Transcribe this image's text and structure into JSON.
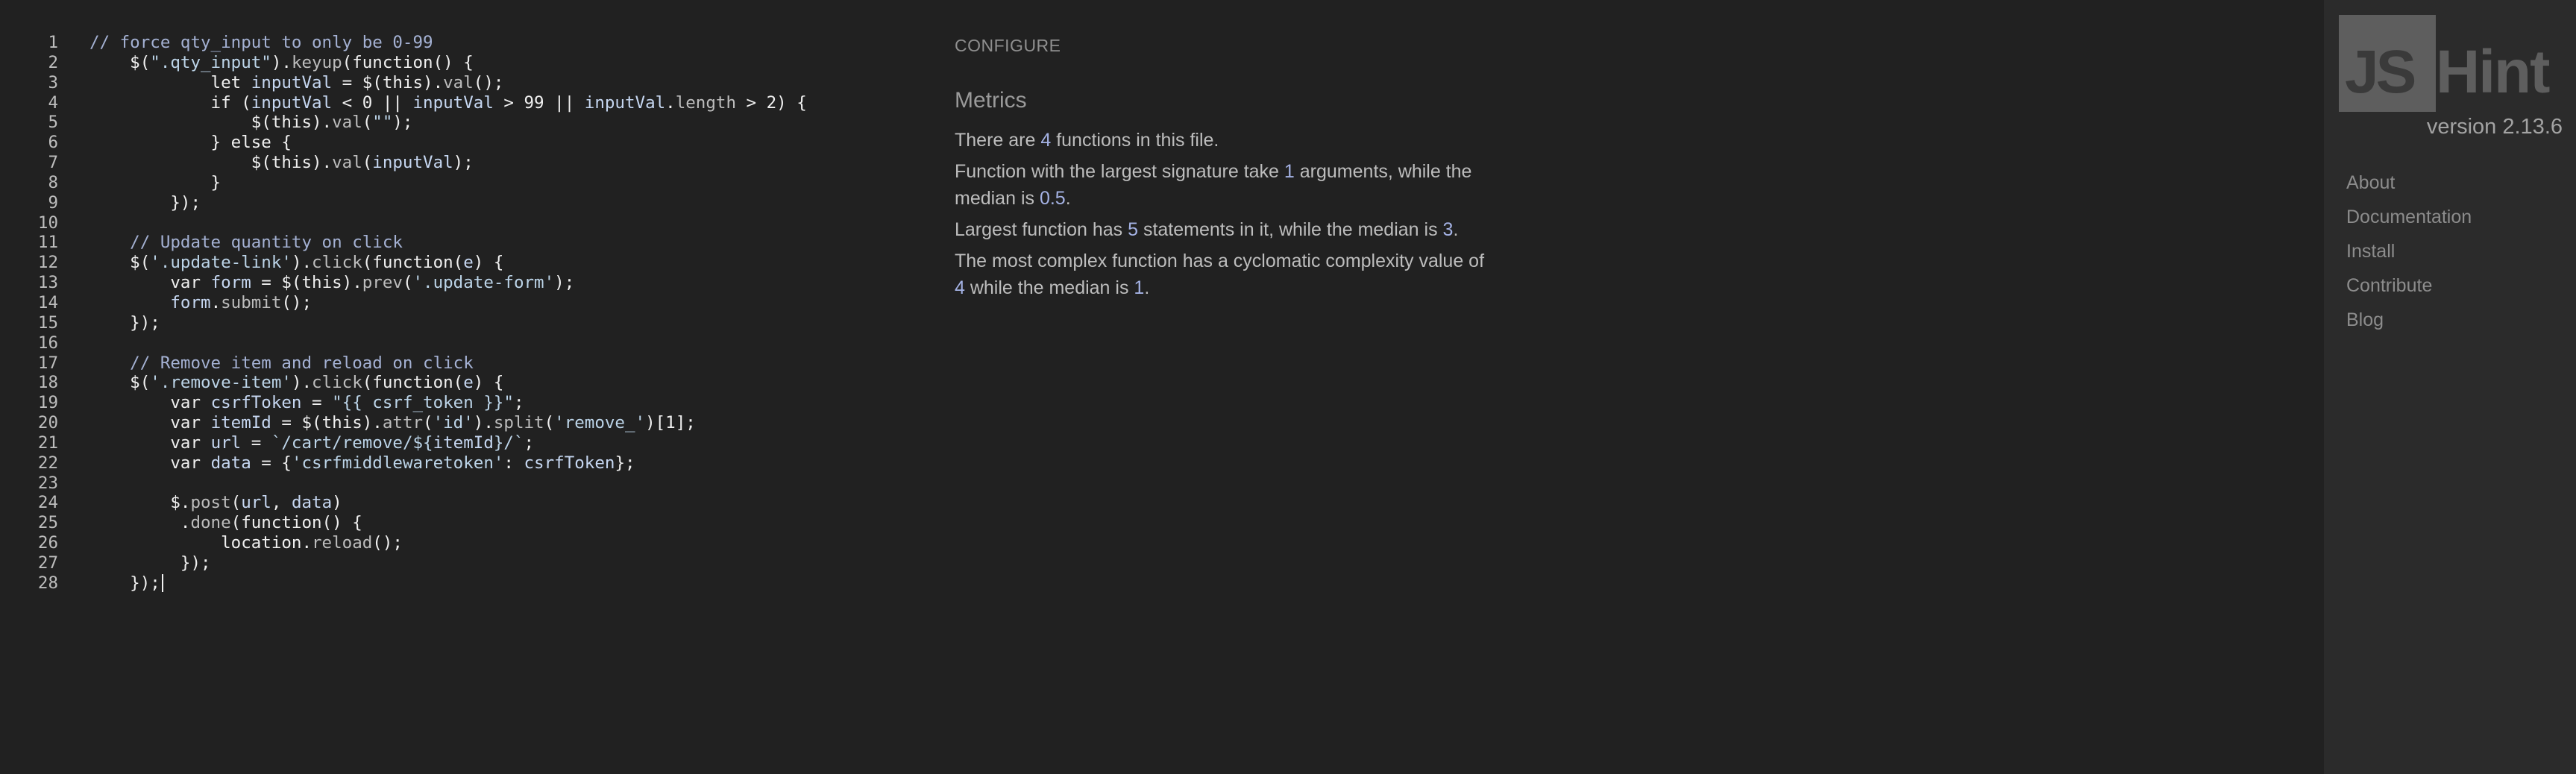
{
  "editor": {
    "lines": [
      {
        "n": "1",
        "tokens": [
          {
            "t": "// force qty_input to only be 0-99",
            "c": "cm"
          }
        ]
      },
      {
        "n": "2",
        "tokens": [
          {
            "t": "    $(",
            "c": "kw"
          },
          {
            "t": "\".qty_input\"",
            "c": "st"
          },
          {
            "t": ").",
            "c": "kw"
          },
          {
            "t": "keyup",
            "c": "mb"
          },
          {
            "t": "(function() {",
            "c": "kw"
          }
        ]
      },
      {
        "n": "3",
        "tokens": [
          {
            "t": "            let ",
            "c": "kw"
          },
          {
            "t": "inputVal",
            "c": "id"
          },
          {
            "t": " = $(this).",
            "c": "kw"
          },
          {
            "t": "val",
            "c": "mb"
          },
          {
            "t": "();",
            "c": "kw"
          }
        ]
      },
      {
        "n": "4",
        "tokens": [
          {
            "t": "            if (",
            "c": "kw"
          },
          {
            "t": "inputVal",
            "c": "id"
          },
          {
            "t": " < 0 || ",
            "c": "kw"
          },
          {
            "t": "inputVal",
            "c": "id"
          },
          {
            "t": " > 99 || ",
            "c": "kw"
          },
          {
            "t": "inputVal",
            "c": "id"
          },
          {
            "t": ".",
            "c": "kw"
          },
          {
            "t": "length",
            "c": "mb"
          },
          {
            "t": " > 2) {",
            "c": "kw"
          }
        ]
      },
      {
        "n": "5",
        "tokens": [
          {
            "t": "                $(this).",
            "c": "kw"
          },
          {
            "t": "val",
            "c": "mb"
          },
          {
            "t": "(",
            "c": "kw"
          },
          {
            "t": "\"\"",
            "c": "st"
          },
          {
            "t": ");",
            "c": "kw"
          }
        ]
      },
      {
        "n": "6",
        "tokens": [
          {
            "t": "            } else {",
            "c": "kw"
          }
        ]
      },
      {
        "n": "7",
        "tokens": [
          {
            "t": "                $(this).",
            "c": "kw"
          },
          {
            "t": "val",
            "c": "mb"
          },
          {
            "t": "(",
            "c": "kw"
          },
          {
            "t": "inputVal",
            "c": "id"
          },
          {
            "t": ");",
            "c": "kw"
          }
        ]
      },
      {
        "n": "8",
        "tokens": [
          {
            "t": "            }",
            "c": "kw"
          }
        ]
      },
      {
        "n": "9",
        "tokens": [
          {
            "t": "        });",
            "c": "kw"
          }
        ]
      },
      {
        "n": "10",
        "tokens": []
      },
      {
        "n": "11",
        "tokens": [
          {
            "t": "    // Update quantity on click",
            "c": "cm"
          }
        ]
      },
      {
        "n": "12",
        "tokens": [
          {
            "t": "    $(",
            "c": "kw"
          },
          {
            "t": "'.update-link'",
            "c": "st"
          },
          {
            "t": ").",
            "c": "kw"
          },
          {
            "t": "click",
            "c": "mb"
          },
          {
            "t": "(function(",
            "c": "kw"
          },
          {
            "t": "e",
            "c": "id"
          },
          {
            "t": ") {",
            "c": "kw"
          }
        ]
      },
      {
        "n": "13",
        "tokens": [
          {
            "t": "        var ",
            "c": "kw"
          },
          {
            "t": "form",
            "c": "id"
          },
          {
            "t": " = $(this).",
            "c": "kw"
          },
          {
            "t": "prev",
            "c": "mb"
          },
          {
            "t": "(",
            "c": "kw"
          },
          {
            "t": "'.update-form'",
            "c": "st"
          },
          {
            "t": ");",
            "c": "kw"
          }
        ]
      },
      {
        "n": "14",
        "tokens": [
          {
            "t": "        ",
            "c": "kw"
          },
          {
            "t": "form",
            "c": "id"
          },
          {
            "t": ".",
            "c": "kw"
          },
          {
            "t": "submit",
            "c": "mb"
          },
          {
            "t": "();",
            "c": "kw"
          }
        ]
      },
      {
        "n": "15",
        "tokens": [
          {
            "t": "    });",
            "c": "kw"
          }
        ]
      },
      {
        "n": "16",
        "tokens": []
      },
      {
        "n": "17",
        "tokens": [
          {
            "t": "    // Remove item and reload on click",
            "c": "cm"
          }
        ]
      },
      {
        "n": "18",
        "tokens": [
          {
            "t": "    $(",
            "c": "kw"
          },
          {
            "t": "'.remove-item'",
            "c": "st"
          },
          {
            "t": ").",
            "c": "kw"
          },
          {
            "t": "click",
            "c": "mb"
          },
          {
            "t": "(function(",
            "c": "kw"
          },
          {
            "t": "e",
            "c": "id"
          },
          {
            "t": ") {",
            "c": "kw"
          }
        ]
      },
      {
        "n": "19",
        "tokens": [
          {
            "t": "        var ",
            "c": "kw"
          },
          {
            "t": "csrfToken",
            "c": "id"
          },
          {
            "t": " = ",
            "c": "kw"
          },
          {
            "t": "\"{{ csrf_token }}\"",
            "c": "st"
          },
          {
            "t": ";",
            "c": "kw"
          }
        ]
      },
      {
        "n": "20",
        "tokens": [
          {
            "t": "        var ",
            "c": "kw"
          },
          {
            "t": "itemId",
            "c": "id"
          },
          {
            "t": " = $(this).",
            "c": "kw"
          },
          {
            "t": "attr",
            "c": "mb"
          },
          {
            "t": "(",
            "c": "kw"
          },
          {
            "t": "'id'",
            "c": "st"
          },
          {
            "t": ").",
            "c": "kw"
          },
          {
            "t": "split",
            "c": "mb"
          },
          {
            "t": "(",
            "c": "kw"
          },
          {
            "t": "'remove_'",
            "c": "st"
          },
          {
            "t": ")[1];",
            "c": "kw"
          }
        ]
      },
      {
        "n": "21",
        "tokens": [
          {
            "t": "        var ",
            "c": "kw"
          },
          {
            "t": "url",
            "c": "id"
          },
          {
            "t": " = ",
            "c": "kw"
          },
          {
            "t": "`/cart/remove/${",
            "c": "st"
          },
          {
            "t": "itemId",
            "c": "id"
          },
          {
            "t": "}/`",
            "c": "st"
          },
          {
            "t": ";",
            "c": "kw"
          }
        ]
      },
      {
        "n": "22",
        "tokens": [
          {
            "t": "        var ",
            "c": "kw"
          },
          {
            "t": "data",
            "c": "id"
          },
          {
            "t": " = {",
            "c": "kw"
          },
          {
            "t": "'csrfmiddlewaretoken'",
            "c": "st"
          },
          {
            "t": ": ",
            "c": "kw"
          },
          {
            "t": "csrfToken",
            "c": "id"
          },
          {
            "t": "};",
            "c": "kw"
          }
        ]
      },
      {
        "n": "23",
        "tokens": []
      },
      {
        "n": "24",
        "tokens": [
          {
            "t": "        $.",
            "c": "kw"
          },
          {
            "t": "post",
            "c": "mb"
          },
          {
            "t": "(",
            "c": "kw"
          },
          {
            "t": "url",
            "c": "id"
          },
          {
            "t": ", ",
            "c": "kw"
          },
          {
            "t": "data",
            "c": "id"
          },
          {
            "t": ")",
            "c": "kw"
          }
        ]
      },
      {
        "n": "25",
        "tokens": [
          {
            "t": "         .",
            "c": "kw"
          },
          {
            "t": "done",
            "c": "mb"
          },
          {
            "t": "(function() {",
            "c": "kw"
          }
        ]
      },
      {
        "n": "26",
        "tokens": [
          {
            "t": "             location.",
            "c": "kw"
          },
          {
            "t": "reload",
            "c": "mb"
          },
          {
            "t": "();",
            "c": "kw"
          }
        ]
      },
      {
        "n": "27",
        "tokens": [
          {
            "t": "         });",
            "c": "kw"
          }
        ]
      },
      {
        "n": "28",
        "tokens": [
          {
            "t": "    });",
            "c": "kw"
          }
        ],
        "cursor": true
      }
    ]
  },
  "report": {
    "configure_label": "CONFIGURE",
    "metrics_title": "Metrics",
    "line1": {
      "a": "There are ",
      "b": "4",
      "c": " functions in this file."
    },
    "line2": {
      "a": "Function with the largest signature take ",
      "b": "1",
      "c": " arguments, while the median is ",
      "d": "0.5",
      "e": "."
    },
    "line3": {
      "a": "Largest function has ",
      "b": "5",
      "c": " statements in it, while the median is ",
      "d": "3",
      "e": "."
    },
    "line4": {
      "a": "The most complex function has a cyclomatic complexity value of ",
      "b": "4",
      "c": " while the median is ",
      "d": "1",
      "e": "."
    }
  },
  "sidebar": {
    "logo_js": "JS",
    "logo_hint": "Hint",
    "version": "version 2.13.6",
    "nav": [
      "About",
      "Documentation",
      "Install",
      "Contribute",
      "Blog"
    ]
  },
  "colors": {
    "background": "#212121",
    "sidebar_background": "#2b2b2b",
    "highlight": "#a4b2e4"
  }
}
